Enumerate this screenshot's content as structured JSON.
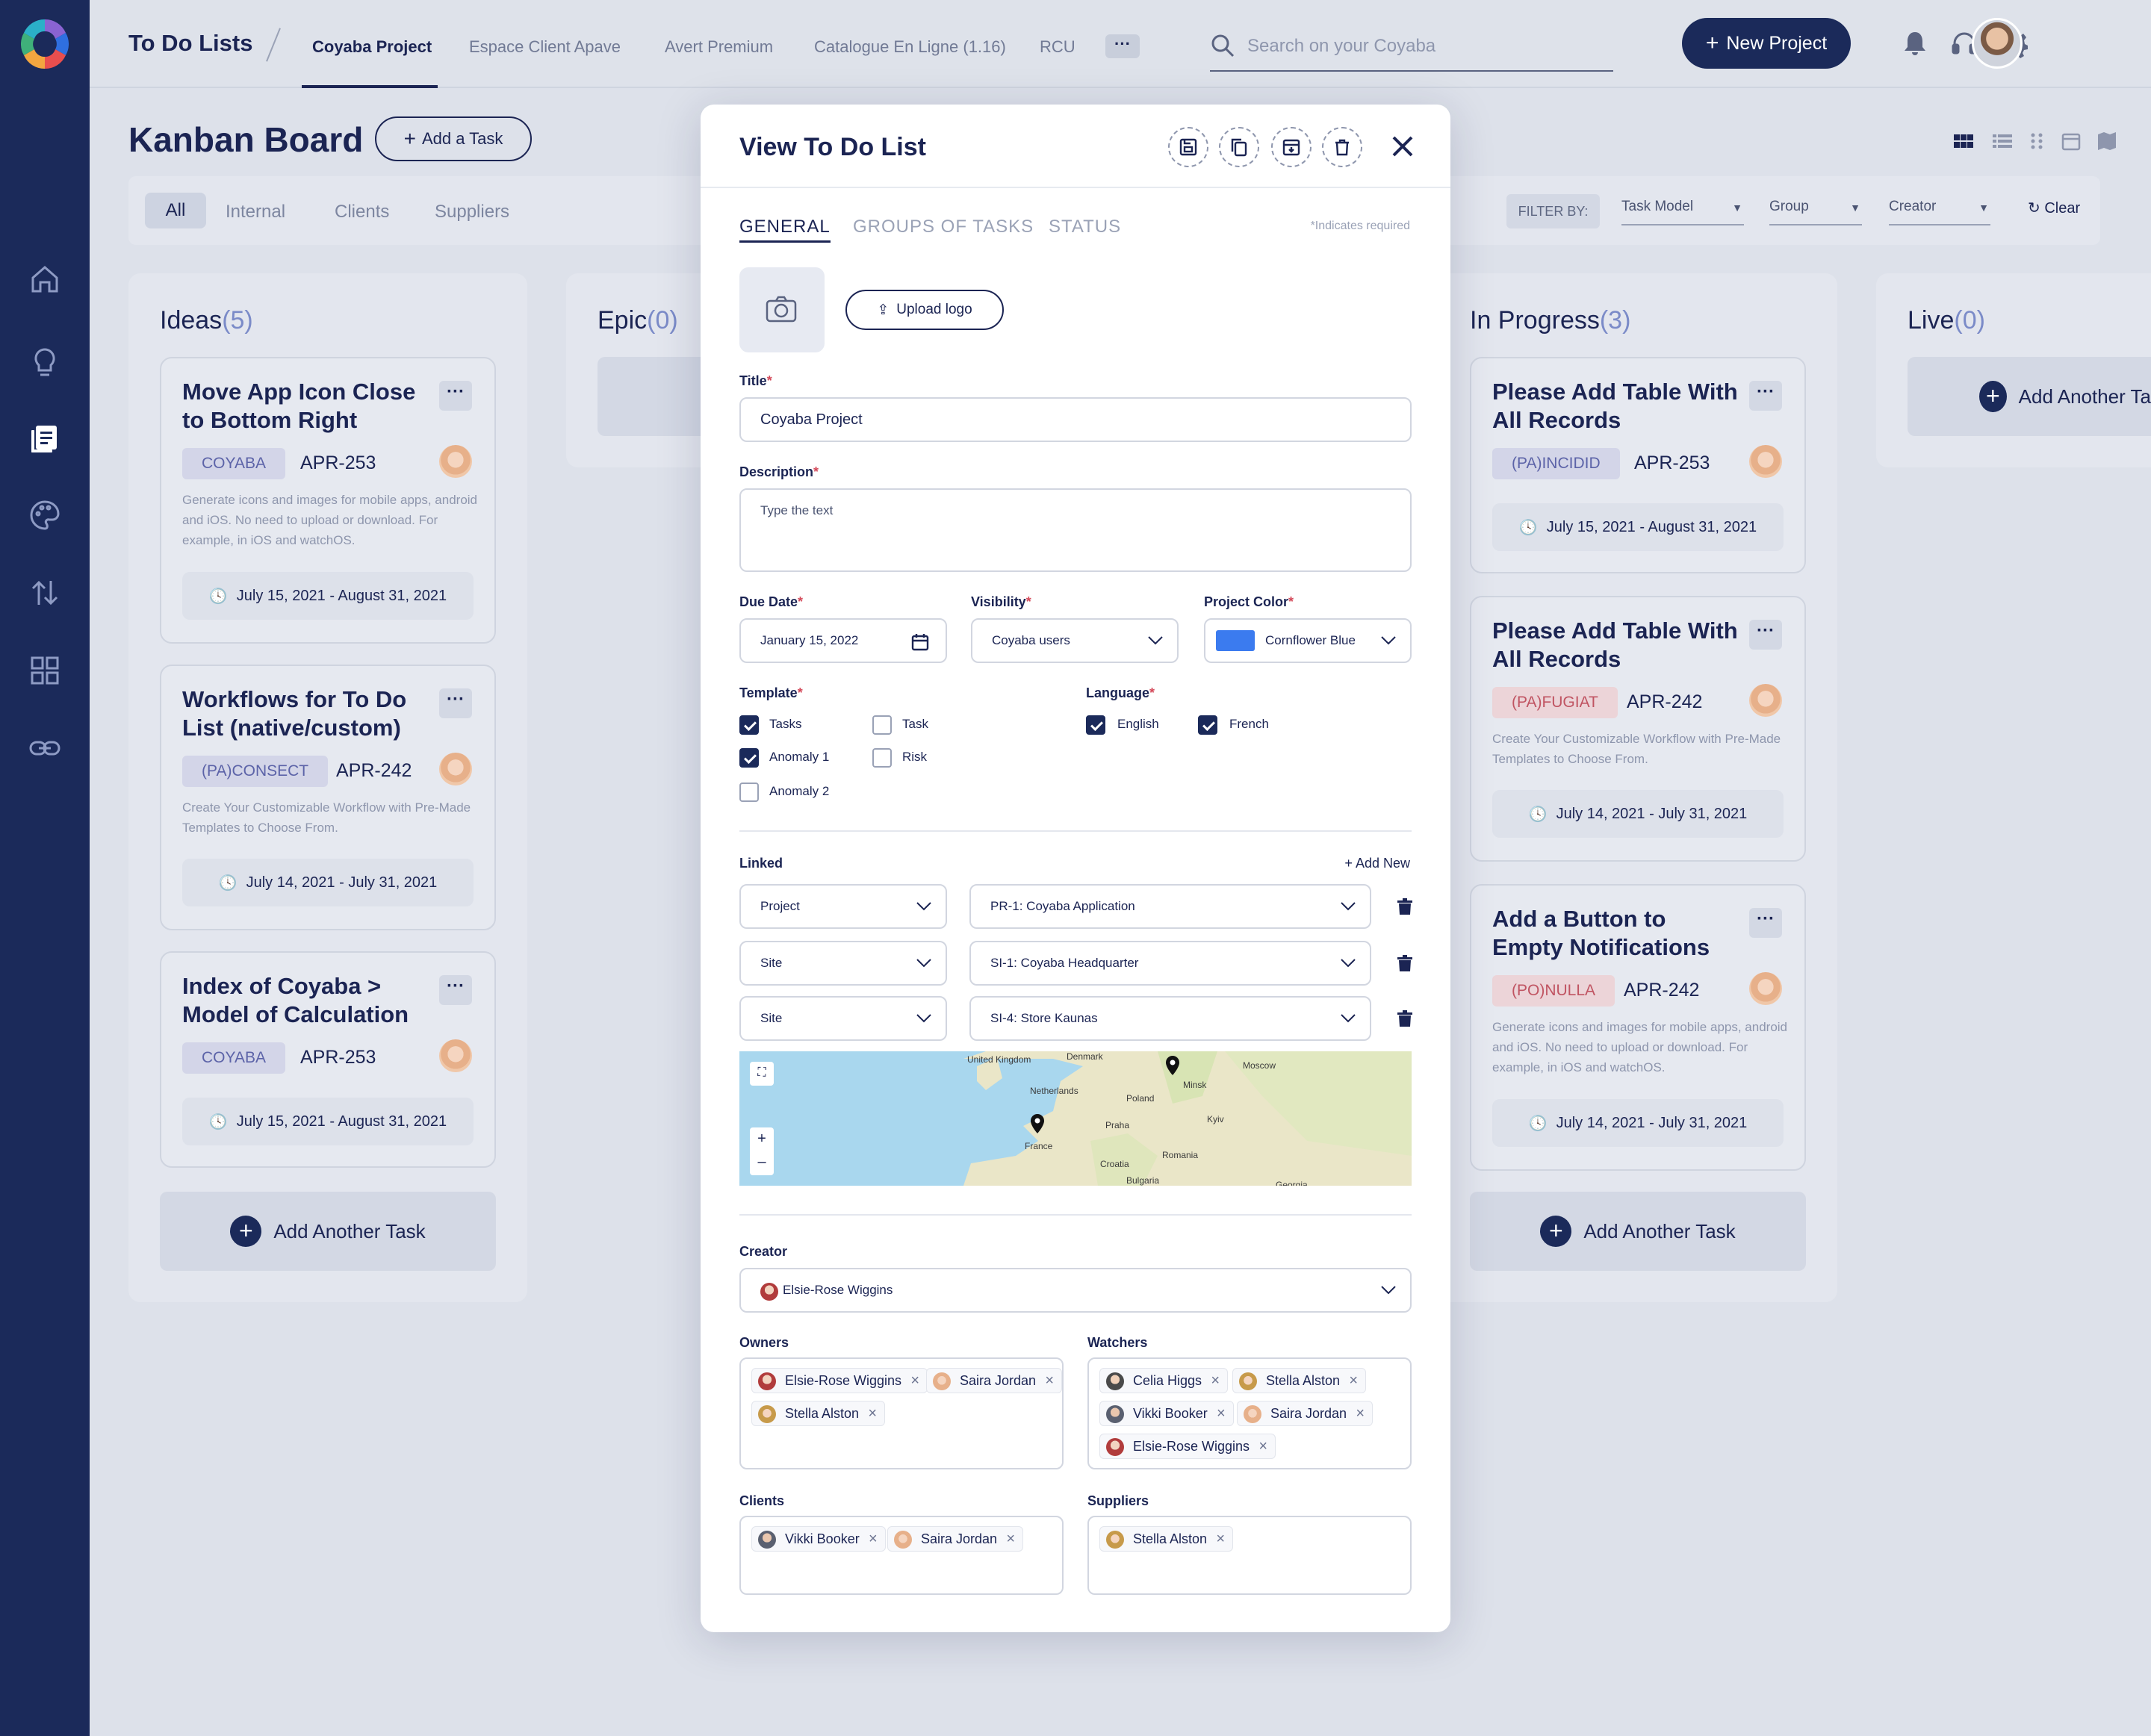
{
  "app": {
    "title": "To Do Lists"
  },
  "tabs": [
    "Coyaba Project",
    "Espace Client Apave",
    "Avert Premium",
    "Catalogue En Ligne (1.16)",
    "RCU"
  ],
  "more_label": "···",
  "search": {
    "placeholder": "Search on your Coyaba"
  },
  "new_project_label": "New Project",
  "page": {
    "title": "Kanban Board",
    "add_task_label": "Add a Task"
  },
  "filters": {
    "tabs": [
      "All",
      "Internal",
      "Clients",
      "Suppliers"
    ],
    "filter_by": "FILTER BY:",
    "selects": [
      "Task Model",
      "Group",
      "Creator"
    ],
    "clear": "Clear"
  },
  "columns": [
    {
      "title": "Ideas",
      "count": "(5)",
      "add_label": "Add Another Task",
      "cards": [
        {
          "title": "Move App Icon Close to Bottom Right",
          "badge": "COYABA",
          "code": "APR-253",
          "desc": "Generate icons and images for mobile apps, android and iOS. No need to upload or download. For example, in iOS and watchOS.",
          "date": "July 15, 2021 - August 31, 2021"
        },
        {
          "title": "Workflows for To Do List (native/custom)",
          "badge": "(PA)CONSECT",
          "code": "APR-242",
          "desc": "Create Your Customizable Workflow with Pre-Made Templates to Choose From.",
          "date": "July 14, 2021 - July 31, 2021"
        },
        {
          "title": "Index of Coyaba > Model of Calculation",
          "badge": "COYABA",
          "code": "APR-253",
          "desc": "",
          "date": "July 15, 2021 - August 31, 2021"
        }
      ]
    },
    {
      "title": "Epic",
      "count": "(0)"
    },
    {
      "title": "In Progress",
      "count": "(3)",
      "add_label": "Add Another Task",
      "cards": [
        {
          "title": "Please Add Table With All Records",
          "badge": "(PA)INCIDID",
          "code": "APR-253",
          "desc": "",
          "date": "July 15, 2021 - August 31, 2021"
        },
        {
          "title": "Please Add Table With All Records",
          "badge": "(PA)FUGIAT",
          "code": "APR-242",
          "desc": "Create Your Customizable Workflow with Pre-Made Templates to Choose From.",
          "date": "July 14, 2021 - July 31, 2021"
        },
        {
          "title": "Add a Button to Empty Notifications",
          "badge": "(PO)NULLA",
          "code": "APR-242",
          "desc": "Generate icons and images for mobile apps, android and iOS. No need to upload or download. For example, in iOS and watchOS.",
          "date": "July 14, 2021 - July 31, 2021"
        }
      ]
    },
    {
      "title": "Live",
      "count": "(0)",
      "add_label": "Add Another Ta"
    }
  ],
  "modal": {
    "title": "View To Do List",
    "tabs": [
      "GENERAL",
      "GROUPS OF TASKS",
      "STATUS"
    ],
    "required_note": "*Indicates required",
    "upload_label": "Upload logo",
    "title_label": "Title",
    "title_value": "Coyaba Project",
    "description_label": "Description",
    "description_placeholder": "Type the text",
    "due_date_label": "Due Date",
    "due_date_value": "January 15, 2022",
    "visibility_label": "Visibility",
    "visibility_value": "Coyaba users",
    "color_label": "Project Color",
    "color_value": "Cornflower Blue",
    "color_hex": "#3b7bef",
    "template_label": "Template",
    "template_options": [
      {
        "label": "Tasks",
        "checked": true
      },
      {
        "label": "Task",
        "checked": false
      },
      {
        "label": "Anomaly 1",
        "checked": true
      },
      {
        "label": "Risk",
        "checked": false
      },
      {
        "label": "Anomaly 2",
        "checked": false
      }
    ],
    "language_label": "Language",
    "language_options": [
      {
        "label": "English",
        "checked": true
      },
      {
        "label": "French",
        "checked": true
      }
    ],
    "linked_label": "Linked",
    "add_new_label": "Add New",
    "linked": [
      {
        "type": "Project",
        "value": "PR-1: Coyaba Application"
      },
      {
        "type": "Site",
        "value": "SI-1: Coyaba Headquarter"
      },
      {
        "type": "Site",
        "value": "SI-4: Store Kaunas"
      }
    ],
    "map_labels": [
      "United Kingdom",
      "Denmark",
      "Netherlands",
      "Poland",
      "Moscow",
      "Minsk",
      "France",
      "Praha",
      "Kyiv",
      "Romania",
      "Croatia",
      "Bulgaria",
      "Georgia"
    ],
    "creator_label": "Creator",
    "creator_value": "Elsie-Rose Wiggins",
    "owners_label": "Owners",
    "owners": [
      "Elsie-Rose Wiggins",
      "Saira Jordan",
      "Stella Alston"
    ],
    "watchers_label": "Watchers",
    "watchers": [
      "Celia Higgs",
      "Stella Alston",
      "Vikki Booker",
      "Saira Jordan",
      "Elsie-Rose Wiggins"
    ],
    "clients_label": "Clients",
    "clients": [
      "Vikki Booker",
      "Saira Jordan"
    ],
    "suppliers_label": "Suppliers",
    "suppliers": [
      "Stella Alston"
    ]
  }
}
